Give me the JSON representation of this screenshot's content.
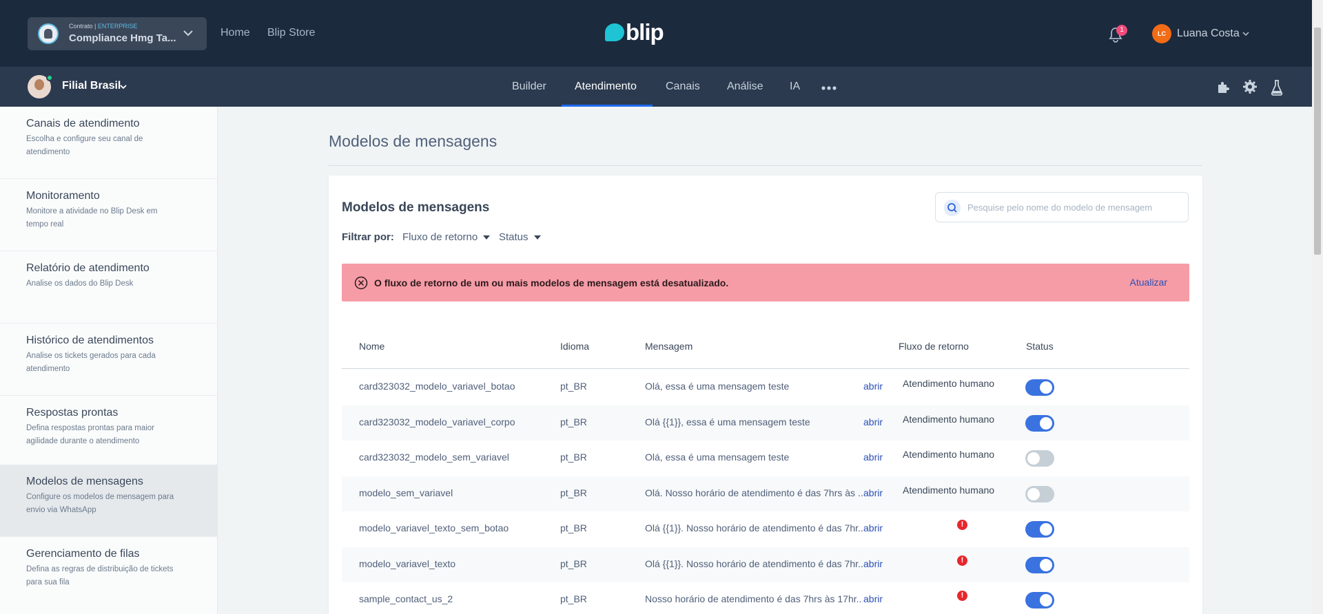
{
  "topbar": {
    "contract_small": "Contrato | ",
    "contract_tier": "ENTERPRISE",
    "contract_name": "Compliance Hmg Ta...",
    "links": [
      "Home",
      "Blip Store"
    ],
    "logo_text": "blip",
    "notification_count": "1",
    "user_initials": "LC",
    "user_name": "Luana Costa"
  },
  "navbar": {
    "bot_name": "Filial Brasil",
    "tabs": [
      "Builder",
      "Atendimento",
      "Canais",
      "Análise",
      "IA"
    ],
    "active_tab": "Atendimento"
  },
  "sidebar": {
    "items": [
      {
        "title": "Canais de atendimento",
        "desc": "Escolha e configure seu canal de atendimento"
      },
      {
        "title": "Monitoramento",
        "desc": "Monitore a atividade no Blip Desk em tempo real"
      },
      {
        "title": "Relatório de atendimento",
        "desc": "Analise os dados do Blip Desk"
      },
      {
        "title": "Histórico de atendimentos",
        "desc": "Analise os tickets gerados para cada atendimento"
      },
      {
        "title": "Respostas prontas",
        "desc": "Defina respostas prontas para maior agilidade durante o atendimento"
      },
      {
        "title": "Modelos de mensagens",
        "desc": "Configure os modelos de mensagem para envio via WhatsApp"
      },
      {
        "title": "Gerenciamento de filas",
        "desc": "Defina as regras de distribuição de tickets para sua fila"
      }
    ],
    "active_index": 5
  },
  "main": {
    "page_title": "Modelos de mensagens",
    "card_title": "Modelos de mensagens",
    "search_placeholder": "Pesquise pelo nome do modelo de mensagem",
    "filter_label": "Filtrar por:",
    "filters": [
      "Fluxo de retorno",
      "Status"
    ],
    "alert_message": "O fluxo de retorno de um ou mais modelos de mensagem está desatualizado.",
    "alert_action": "Atualizar",
    "columns": [
      "Nome",
      "Idioma",
      "Mensagem",
      "Fluxo de retorno",
      "Status"
    ],
    "rows": [
      {
        "name": "card323032_modelo_variavel_botao",
        "lang": "pt_BR",
        "message": "Olá, essa é uma mensagem teste",
        "link": "abrir",
        "flow": "Atendimento humano",
        "flow_error": false,
        "status": true
      },
      {
        "name": "card323032_modelo_variavel_corpo",
        "lang": "pt_BR",
        "message": "Olá {{1}}, essa é uma mensagem teste",
        "link": "abrir",
        "flow": "Atendimento humano",
        "flow_error": false,
        "status": true
      },
      {
        "name": "card323032_modelo_sem_variavel",
        "lang": "pt_BR",
        "message": "Olá, essa é uma mensagem teste",
        "link": "abrir",
        "flow": "Atendimento humano",
        "flow_error": false,
        "status": false
      },
      {
        "name": "modelo_sem_variavel",
        "lang": "pt_BR",
        "message": "Olá. Nosso horário de atendimento é das 7hrs às ...",
        "link": "abrir",
        "flow": "Atendimento humano",
        "flow_error": false,
        "status": false
      },
      {
        "name": "modelo_variavel_texto_sem_botao",
        "lang": "pt_BR",
        "message": "Olá {{1}}. Nosso horário de atendimento é das 7hr...",
        "link": "abrir",
        "flow": "",
        "flow_error": true,
        "status": true
      },
      {
        "name": "modelo_variavel_texto",
        "lang": "pt_BR",
        "message": "Olá {{1}}. Nosso horário de atendimento é das 7hr...",
        "link": "abrir",
        "flow": "",
        "flow_error": true,
        "status": true
      },
      {
        "name": "sample_contact_us_2",
        "lang": "pt_BR",
        "message": "Nosso horário de atendimento é das 7hrs às 17hr...",
        "link": "abrir",
        "flow": "",
        "flow_error": true,
        "status": true
      }
    ]
  }
}
